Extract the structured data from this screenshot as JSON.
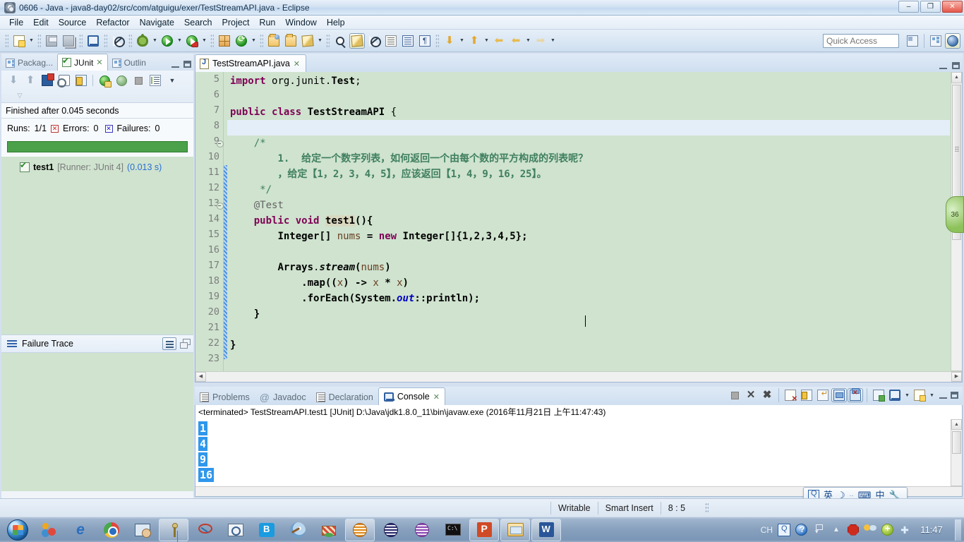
{
  "window": {
    "title": "0606 - Java - java8-day02/src/com/atguigu/exer/TestStreamAPI.java - Eclipse",
    "app_icon": "eclipse-icon",
    "minimize": "–",
    "maximize": "❐",
    "close": "✕"
  },
  "menubar": {
    "items": [
      {
        "label": "File"
      },
      {
        "label": "Edit"
      },
      {
        "label": "Source"
      },
      {
        "label": "Refactor"
      },
      {
        "label": "Navigate"
      },
      {
        "label": "Search"
      },
      {
        "label": "Project"
      },
      {
        "label": "Run"
      },
      {
        "label": "Window"
      },
      {
        "label": "Help"
      }
    ]
  },
  "toolbar": {
    "quick_access_placeholder": "Quick Access",
    "icons": [
      "new-wizard-icon",
      "save-icon",
      "save-all-icon",
      "print-icon",
      "toggle-breakpoint-icon",
      "debug-icon",
      "run-icon",
      "run-external-tools-icon",
      "new-java-package-icon",
      "refresh-icon",
      "open-type-icon",
      "open-task-icon",
      "search-icon",
      "last-edit-location-icon",
      "toggle-mark-occurrences-icon",
      "skip-all-breakpoints-icon",
      "next-annotation-icon",
      "previous-annotation-icon",
      "show-whitespace-icon",
      "back-icon",
      "forward-icon"
    ],
    "right_icons": [
      "new-java-project-icon",
      "java-browsing-perspective-icon",
      "java-perspective-icon"
    ]
  },
  "left_panel": {
    "tabs": [
      {
        "label": "Packag...",
        "icon": "package-explorer-icon",
        "active": false
      },
      {
        "label": "JUnit",
        "icon": "junit-icon",
        "active": true
      },
      {
        "label": "Outlin",
        "icon": "outline-icon",
        "active": false
      }
    ],
    "junit": {
      "toolbar_icons": [
        "next-failure-icon",
        "previous-failure-icon",
        "show-failures-only-icon",
        "scroll-lock-icon",
        "pin-test-icon",
        "rerun-test-icon",
        "rerun-test-failures-icon",
        "stop-icon",
        "test-history-icon",
        "view-menu-icon"
      ],
      "status": "Finished after 0.045 seconds",
      "runs_label": "Runs:",
      "runs_value": "1/1",
      "errors_label": "Errors:",
      "errors_value": "0",
      "failures_label": "Failures:",
      "failures_value": "0",
      "progress_color": "#4aa14a",
      "progress_percent": 100,
      "tree": [
        {
          "name": "test1",
          "runner": "[Runner: JUnit 4]",
          "time": "(0.013 s)",
          "icon": "test-passed-icon"
        }
      ]
    },
    "failure_trace": {
      "title": "Failure Trace",
      "icon": "failure-trace-icon",
      "buttons": [
        "filter-stack-trace-icon",
        "restore-icon"
      ],
      "content": ""
    }
  },
  "editor": {
    "tab": {
      "label": "TestStreamAPI.java",
      "icon": "java-file-icon",
      "close": "✕"
    },
    "first_line_number": 5,
    "current_line": 8,
    "lines": [
      {
        "n": 5,
        "fold": false,
        "html": "<span class=\"kw\">import</span> <span class=\"id\">org</span>.<span class=\"id\">junit</span>.<span class=\"cls\">Test</span>;"
      },
      {
        "n": 6,
        "fold": false,
        "html": ""
      },
      {
        "n": 7,
        "fold": false,
        "html": "<span class=\"kw\">public</span> <span class=\"kw\">class</span> <span class=\"cls\">TestStreamAPI</span> {"
      },
      {
        "n": 8,
        "fold": false,
        "html": ""
      },
      {
        "n": 9,
        "fold": true,
        "html": "    <span class=\"cmt\">/*</span>"
      },
      {
        "n": 10,
        "fold": false,
        "html": "        <span class=\"cmt-b\">1.  给定一个数字列表，如何返回一个由每个数的平方构成的列表呢？</span>"
      },
      {
        "n": 11,
        "fold": false,
        "html": "        <span class=\"cmt-b\">，给定【1，2，3，4，5】，应该返回【1，4，9，16，25】。</span>"
      },
      {
        "n": 12,
        "fold": false,
        "html": "     <span class=\"cmt\">*/</span>"
      },
      {
        "n": 13,
        "fold": true,
        "html": "    <span class=\"anno\">@Test</span>"
      },
      {
        "n": 14,
        "fold": false,
        "html": "    <span class=\"kw\">public</span> <span class=\"kw\">void</span> <span class=\"occ bold\">test1</span><span class=\"bold\">(){</span>"
      },
      {
        "n": 15,
        "fold": false,
        "html": "        <span class=\"cls\">Integer</span><span class=\"bold\">[]</span> <span class=\"localv\">nums</span> <span class=\"bold\">=</span> <span class=\"kw\">new</span> <span class=\"cls\">Integer</span><span class=\"bold\">[]{1,2,3,4,5};</span>"
      },
      {
        "n": 16,
        "fold": false,
        "html": ""
      },
      {
        "n": 17,
        "fold": false,
        "html": "        <span class=\"cls\">Arrays</span>.<span class=\"statm\">stream</span><span class=\"bold\">(</span><span class=\"localv\">nums</span><span class=\"bold\">)</span>"
      },
      {
        "n": 18,
        "fold": false,
        "html": "            <span class=\"bold\">.map((</span><span class=\"localv\">x</span><span class=\"bold\">) -&gt; </span><span class=\"localv\">x</span><span class=\"bold\"> * </span><span class=\"localv\">x</span><span class=\"bold\">)</span>"
      },
      {
        "n": 19,
        "fold": false,
        "html": "            <span class=\"bold\">.forEach(</span><span class=\"cls\">System</span><span class=\"bold\">.</span><span class=\"statf\">out</span><span class=\"bold\">::println);</span>"
      },
      {
        "n": 20,
        "fold": false,
        "html": "    <span class=\"bold\">}</span>"
      },
      {
        "n": 21,
        "fold": false,
        "html": ""
      },
      {
        "n": 22,
        "fold": false,
        "html": "<span class=\"bold\">}</span>"
      },
      {
        "n": 23,
        "fold": false,
        "html": ""
      }
    ]
  },
  "console_panel": {
    "tabs": [
      {
        "label": "Problems",
        "icon": "problems-icon",
        "active": false
      },
      {
        "label": "Javadoc",
        "icon": "javadoc-icon",
        "active": false
      },
      {
        "label": "Declaration",
        "icon": "declaration-icon",
        "active": false
      },
      {
        "label": "Console",
        "icon": "console-icon",
        "active": true
      }
    ],
    "toolbar_icons": [
      "terminate-icon",
      "remove-launch-icon",
      "remove-all-terminated-icon",
      "clear-console-icon",
      "scroll-lock-icon",
      "word-wrap-icon",
      "show-console-on-output-icon",
      "show-console-on-error-icon",
      "pin-console-icon",
      "display-selected-console-icon",
      "open-console-icon",
      "minimize-icon",
      "maximize-icon"
    ],
    "status_line": "<terminated> TestStreamAPI.test1 [JUnit] D:\\Java\\jdk1.8.0_11\\bin\\javaw.exe (2016年11月21日 上午11:47:43)",
    "output_lines": [
      "1",
      "4",
      "9",
      "16"
    ],
    "selection_color": "#2f97ec"
  },
  "ime_bar": {
    "items": [
      "ime-logo-icon",
      "英",
      "moon-icon",
      "··",
      "keyboard-icon",
      "half-width-icon",
      "tools-icon"
    ]
  },
  "status_bar": {
    "writable": "Writable",
    "insert_mode": "Smart Insert",
    "cursor_position": "8 : 5"
  },
  "taskbar": {
    "start": "start-orb-icon",
    "pinned": [
      {
        "icon": "flower-app-icon",
        "active": false
      },
      {
        "icon": "internet-explorer-icon",
        "active": false
      },
      {
        "icon": "google-chrome-icon",
        "active": false
      },
      {
        "icon": "remote-desktop-icon",
        "active": false
      },
      {
        "icon": "keyshot-icon",
        "active": true
      },
      {
        "icon": "scissors-icon",
        "active": false
      },
      {
        "icon": "snipping-tool-icon",
        "active": false
      },
      {
        "icon": "baidu-cloud-icon",
        "active": false
      },
      {
        "icon": "paint-icon",
        "active": false
      },
      {
        "icon": "cake-app-icon",
        "active": false
      },
      {
        "icon": "eclipse-orange-icon",
        "active": true
      },
      {
        "icon": "eclipse-dark-icon",
        "active": false
      },
      {
        "icon": "eclipse-purple-icon",
        "active": false
      },
      {
        "icon": "command-prompt-icon",
        "active": false
      },
      {
        "icon": "powerpoint-icon",
        "active": true
      },
      {
        "icon": "file-explorer-icon",
        "active": true
      },
      {
        "icon": "word-icon",
        "active": true
      }
    ],
    "tray": [
      "ime-indicator-icon",
      "help-icon",
      "network-icon",
      "show-hidden-icon",
      "stop-icon",
      "weather-icon",
      "security-icon",
      "bluetooth-icon"
    ],
    "clock": "11:47",
    "tray_text_ch": "CH"
  },
  "float_bubble": {
    "label": "36"
  }
}
